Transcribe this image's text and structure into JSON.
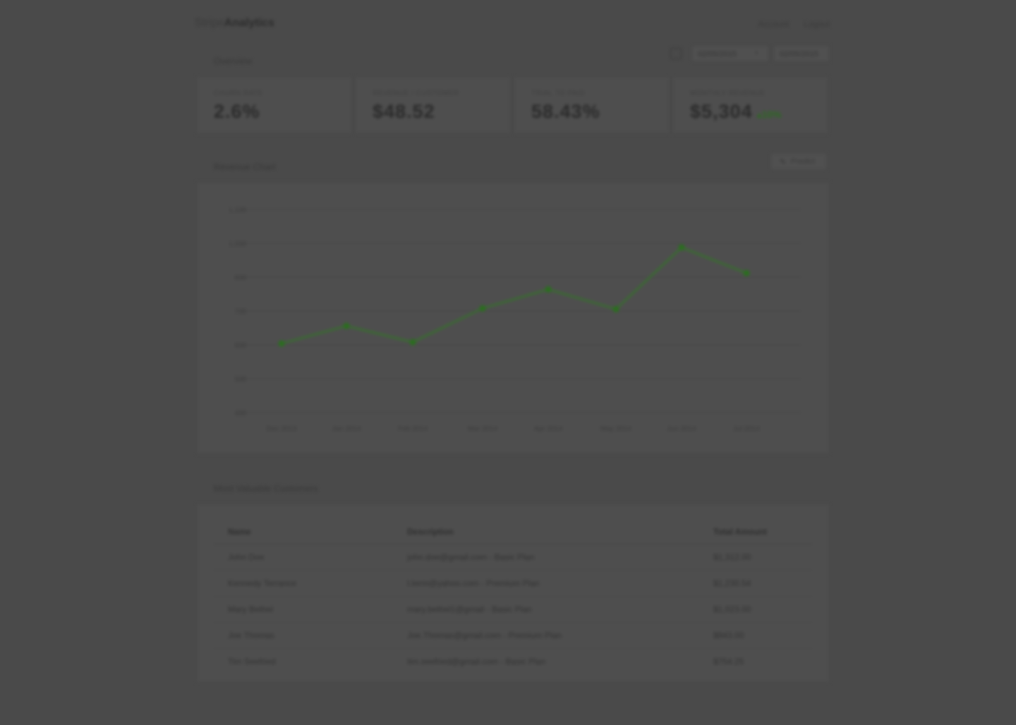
{
  "header": {
    "brand_prefix": "Stripe",
    "brand_name": "Analytics",
    "links": [
      "Account",
      "Logout"
    ]
  },
  "overview": {
    "title": "Overview",
    "date_from": "02/05/2015",
    "date_to": "02/05/2015"
  },
  "kpis": [
    {
      "label": "CHURN RATE",
      "value": "2.6%",
      "delta": ""
    },
    {
      "label": "REVENUE / CUSTOMER",
      "value": "$48.52",
      "delta": ""
    },
    {
      "label": "TRIAL TO PAID",
      "value": "58.43%",
      "delta": ""
    },
    {
      "label": "MONTHLY REVENUE",
      "value": "$5,304",
      "delta": "▴10%"
    }
  ],
  "revenue": {
    "title": "Revenue Chart",
    "predict_label": "Predict"
  },
  "chart_data": {
    "type": "line",
    "categories": [
      "Dec 2013",
      "Jan 2014",
      "Feb 2014",
      "Mar 2014",
      "Apr 2014",
      "May 2014",
      "Jun 2014",
      "Jul 2014"
    ],
    "values": [
      655,
      720,
      660,
      785,
      855,
      782,
      1010,
      915
    ],
    "ylim": [
      400,
      1150
    ],
    "yticks": [
      "400",
      "500",
      "600",
      "700",
      "800",
      "1,000",
      "1,100"
    ],
    "grid": true,
    "color": "#2f7a22"
  },
  "customers": {
    "title": "Most Valuable Customers",
    "columns": [
      "Name",
      "Description",
      "Total Amount"
    ],
    "rows": [
      [
        "John Doe",
        "john.doe@gmail.com - Basic Plan",
        "$1,312.00"
      ],
      [
        "Kennedy Terrance",
        "t.term@yahoo.com - Premium Plan",
        "$1,230.54"
      ],
      [
        "Mary Bethel",
        "mary.bethel1@gmail - Basic Plan",
        "$1,023.00"
      ],
      [
        "Joe Thomas",
        "Joe.Thomas@gmail.com - Premium Plan",
        "$943.00"
      ],
      [
        "Tim Seefried",
        "tim.seefried@gmail.com - Basic Plan",
        "$754.25"
      ]
    ]
  }
}
